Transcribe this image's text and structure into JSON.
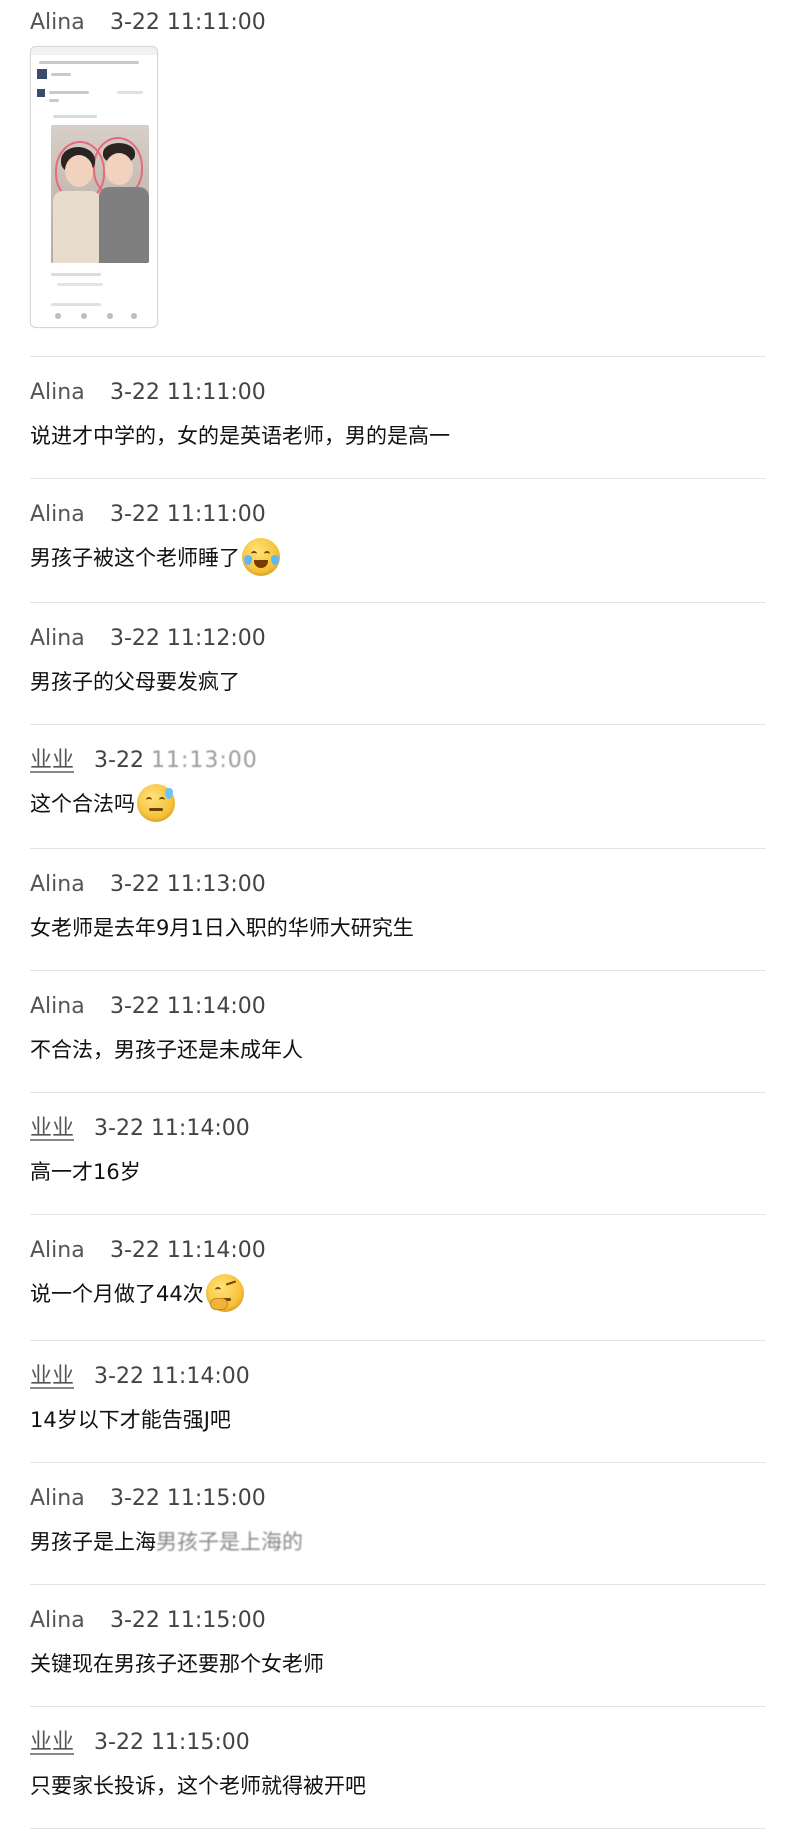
{
  "messages": [
    {
      "sender": "Alina",
      "time": "3-22 11:11:00",
      "text": ""
    },
    {
      "sender": "Alina",
      "time": "3-22 11:11:00",
      "text": "说进才中学的，女的是英语老师，男的是高一"
    },
    {
      "sender": "Alina",
      "time": "3-22 11:11:00",
      "text": "男孩子被这个老师睡了",
      "emoji": "laughing-crying-emoji"
    },
    {
      "sender": "Alina",
      "time": "3-22 11:12:00",
      "text": "男孩子的父母要发疯了"
    },
    {
      "sender": "业业",
      "time": "3-22",
      "time_tail": "11:13:00",
      "text": "这个合法吗",
      "emoji": "cold-sweat-emoji"
    },
    {
      "sender": "Alina",
      "time": "3-22 11:13:00",
      "text": "女老师是去年9月1日入职的华师大研究生"
    },
    {
      "sender": "Alina",
      "time": "3-22 11:14:00",
      "text": "不合法，男孩子还是未成年人"
    },
    {
      "sender": "业业",
      "time": "3-22 11:14:00",
      "text": "高一才16岁"
    },
    {
      "sender": "Alina",
      "time": "3-22 11:14:00",
      "text": "说一个月做了44次",
      "emoji": "thinking-emoji"
    },
    {
      "sender": "业业",
      "time": "3-22 11:14:00",
      "text": "14岁以下才能告强J吧"
    },
    {
      "sender": "Alina",
      "time": "3-22 11:15:00",
      "text": "男孩子是上海",
      "text_tail": "男孩子是上海的"
    },
    {
      "sender": "Alina",
      "time": "3-22 11:15:00",
      "text": "关键现在男孩子还要那个女老师"
    },
    {
      "sender": "业业",
      "time": "3-22 11:15:00",
      "text": "只要家长投诉，这个老师就得被开吧"
    }
  ],
  "attachment": {
    "type": "shared-screenshot-thumbnail"
  }
}
